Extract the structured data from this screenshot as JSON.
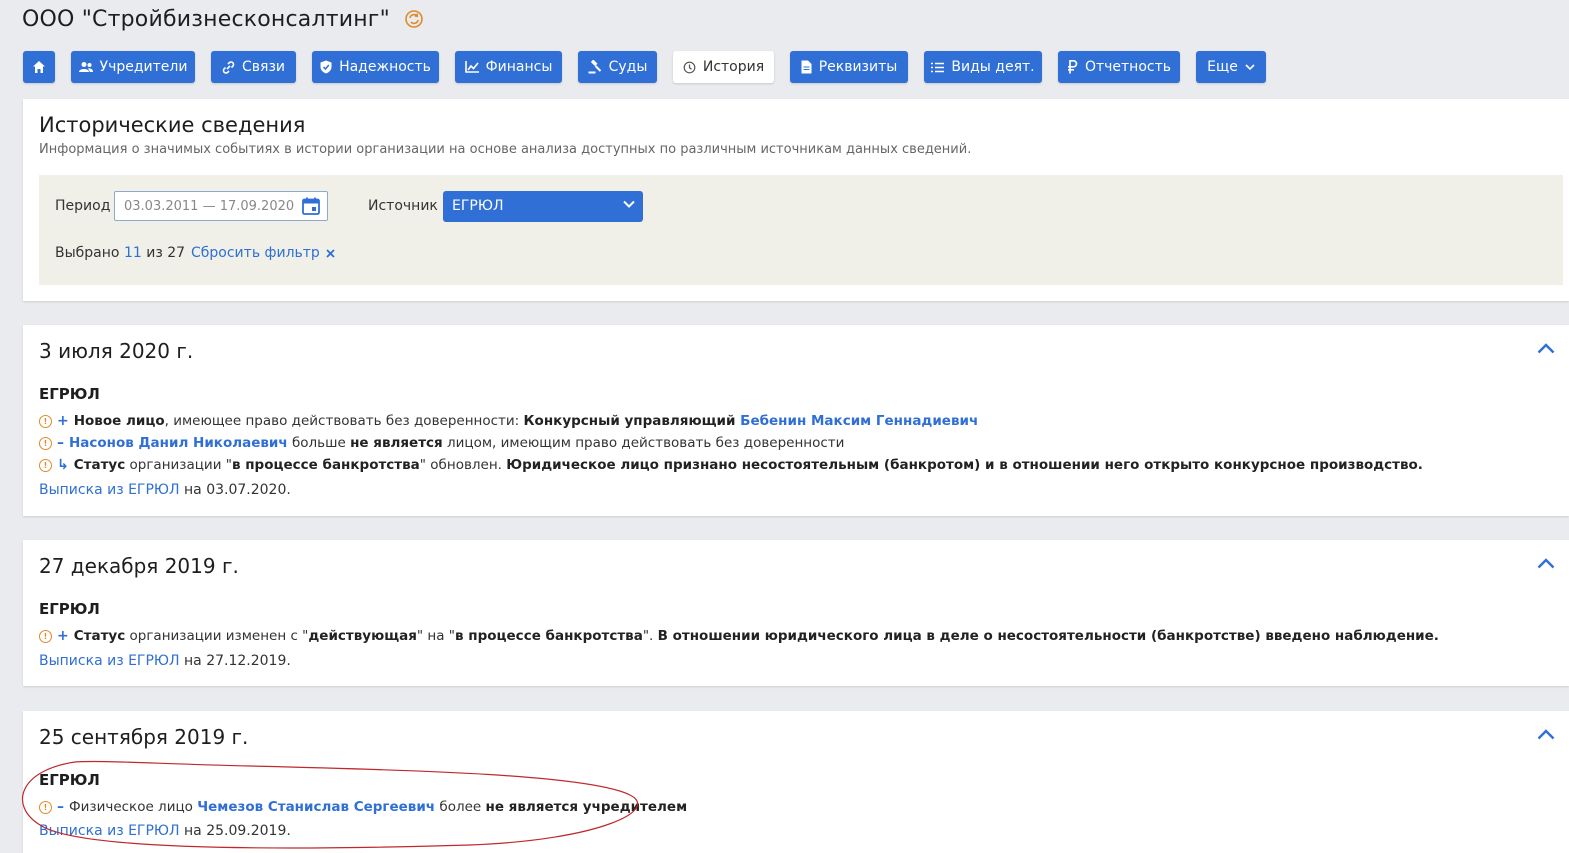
{
  "company": {
    "name": "ООО \"Стройбизнесконсалтинг\"",
    "sync_icon": "sync-icon"
  },
  "nav": [
    {
      "label": "",
      "icon": "home-icon",
      "active": false
    },
    {
      "label": "Учредители",
      "icon": "users-icon",
      "active": false
    },
    {
      "label": "Связи",
      "icon": "link-icon",
      "active": false
    },
    {
      "label": "Надежность",
      "icon": "shield-icon",
      "active": false
    },
    {
      "label": "Финансы",
      "icon": "chart-icon",
      "active": false
    },
    {
      "label": "Суды",
      "icon": "gavel-icon",
      "active": false
    },
    {
      "label": "История",
      "icon": "history-icon",
      "active": true
    },
    {
      "label": "Реквизиты",
      "icon": "document-icon",
      "active": false
    },
    {
      "label": "Виды деят.",
      "icon": "list-icon",
      "active": false
    },
    {
      "label": "Отчетность",
      "icon": "ruble-icon",
      "active": false
    },
    {
      "label": "Еще",
      "icon": "chevron-down-icon",
      "active": false
    }
  ],
  "history": {
    "title": "Исторические сведения",
    "subtitle": "Информация о значимых событиях в истории организации на основе анализа доступных по различным источникам данных сведений.",
    "filter": {
      "period_label": "Период",
      "period_value": "03.03.2011 — 17.09.2020",
      "source_label": "Источник",
      "source_value": "ЕГРЮЛ",
      "selected_prefix": "Выбрано",
      "selected_count": "11",
      "selected_sep": "из",
      "selected_total": "27",
      "reset_label": "Сбросить фильтр"
    }
  },
  "events": [
    {
      "date": "3 июля 2020 г.",
      "source": "ЕГРЮЛ",
      "items": [
        {
          "mark": "+",
          "parts": [
            {
              "t": "Новое лицо",
              "s": "b"
            },
            {
              "t": ", имеющее право действовать без доверенности: ",
              "s": ""
            },
            {
              "t": "Конкурсный управляющий ",
              "s": "b"
            },
            {
              "t": "Бебенин Максим Геннадиевич",
              "s": "l"
            }
          ]
        },
        {
          "mark": "–",
          "parts": [
            {
              "t": "Насонов Данил Николаевич",
              "s": "l"
            },
            {
              "t": " больше ",
              "s": ""
            },
            {
              "t": "не является",
              "s": "b"
            },
            {
              "t": " лицом, имеющим право действовать без доверенности",
              "s": ""
            }
          ]
        },
        {
          "mark": "↳",
          "parts": [
            {
              "t": "Статус",
              "s": "b"
            },
            {
              "t": " организации \"",
              "s": ""
            },
            {
              "t": "в процессе банкротства",
              "s": "b"
            },
            {
              "t": "\" обновлен. ",
              "s": ""
            },
            {
              "t": "Юридическое лицо признано несостоятельным (банкротом) и в отношении него открыто конкурсное производство.",
              "s": "b"
            }
          ]
        }
      ],
      "extract_link": "Выписка из ЕГРЮЛ",
      "extract_date": "на 03.07.2020."
    },
    {
      "date": "27 декабря 2019 г.",
      "source": "ЕГРЮЛ",
      "items": [
        {
          "mark": "+",
          "parts": [
            {
              "t": "Статус",
              "s": "b"
            },
            {
              "t": " организации изменен с \"",
              "s": ""
            },
            {
              "t": "действующая",
              "s": "b"
            },
            {
              "t": "\" на \"",
              "s": ""
            },
            {
              "t": "в процессе банкротства",
              "s": "b"
            },
            {
              "t": "\". ",
              "s": ""
            },
            {
              "t": "В отношении юридического лица в деле о несостоятельности (банкротстве) введено наблюдение.",
              "s": "b"
            }
          ]
        }
      ],
      "extract_link": "Выписка из ЕГРЮЛ",
      "extract_date": "на 27.12.2019."
    },
    {
      "date": "25 сентября 2019 г.",
      "source": "ЕГРЮЛ",
      "items": [
        {
          "mark": "–",
          "parts": [
            {
              "t": "Физическое лицо ",
              "s": ""
            },
            {
              "t": "Чемезов Станислав Сергеевич",
              "s": "l"
            },
            {
              "t": " более ",
              "s": ""
            },
            {
              "t": "не является учредителем",
              "s": "b"
            }
          ]
        }
      ],
      "extract_link": "Выписка из ЕГРЮЛ",
      "extract_date": "на 25.09.2019."
    }
  ],
  "colors": {
    "accent": "#2f6fd6",
    "warning": "#e08a2a",
    "annotation": "#c0282b"
  }
}
